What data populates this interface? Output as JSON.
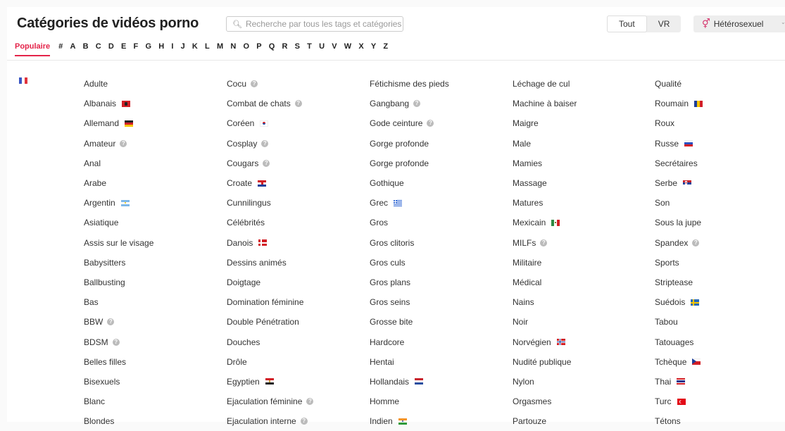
{
  "header": {
    "title": "Catégories de vidéos porno",
    "search_placeholder": "Recherche par tous les tags et catégories",
    "tabs": [
      {
        "label": "Tout",
        "active": true
      },
      {
        "label": "VR",
        "active": false
      }
    ],
    "orientation": {
      "label": "Hétérosexuel",
      "icon": "hetero-gender-icon"
    }
  },
  "letters": [
    "Populaire",
    "#",
    "A",
    "B",
    "C",
    "D",
    "E",
    "F",
    "G",
    "H",
    "I",
    "J",
    "K",
    "L",
    "M",
    "N",
    "O",
    "P",
    "Q",
    "R",
    "S",
    "T",
    "U",
    "V",
    "W",
    "X",
    "Y",
    "Z"
  ],
  "colors": {
    "accent": "#e4244a",
    "help_badge": "#bbbbbb"
  },
  "columns": [
    [
      {
        "name": "Adulte"
      },
      {
        "name": "Albanais",
        "flag": "albania-flag"
      },
      {
        "name": "Allemand",
        "flag": "germany-flag"
      },
      {
        "name": "Amateur",
        "help": true
      },
      {
        "name": "Anal"
      },
      {
        "name": "Arabe"
      },
      {
        "name": "Argentin",
        "flag": "argentina-flag"
      },
      {
        "name": "Asiatique"
      },
      {
        "name": "Assis sur le visage"
      },
      {
        "name": "Babysitters"
      },
      {
        "name": "Ballbusting"
      },
      {
        "name": "Bas"
      },
      {
        "name": "BBW",
        "help": true
      },
      {
        "name": "BDSM",
        "help": true
      },
      {
        "name": "Belles filles"
      },
      {
        "name": "Bisexuels"
      },
      {
        "name": "Blanc"
      },
      {
        "name": "Blondes"
      }
    ],
    [
      {
        "name": "Cocu",
        "help": true
      },
      {
        "name": "Combat de chats",
        "help": true
      },
      {
        "name": "Coréen",
        "flag": "korea-flag"
      },
      {
        "name": "Cosplay",
        "help": true
      },
      {
        "name": "Cougars",
        "help": true
      },
      {
        "name": "Croate",
        "flag": "croatia-flag"
      },
      {
        "name": "Cunnilingus"
      },
      {
        "name": "Célébrités"
      },
      {
        "name": "Danois",
        "flag": "denmark-flag"
      },
      {
        "name": "Dessins animés"
      },
      {
        "name": "Doigtage"
      },
      {
        "name": "Domination féminine"
      },
      {
        "name": "Double Pénétration"
      },
      {
        "name": "Douches"
      },
      {
        "name": "Drôle"
      },
      {
        "name": "Egyptien",
        "flag": "egypt-flag"
      },
      {
        "name": "Ejaculation féminine",
        "help": true
      },
      {
        "name": "Ejaculation interne",
        "help": true
      }
    ],
    [
      {
        "name": "Fétichisme des pieds"
      },
      {
        "name": "Gangbang",
        "help": true
      },
      {
        "name": "Gode ceinture",
        "help": true
      },
      {
        "name": "Gorge profonde"
      },
      {
        "name": "Gorge profonde"
      },
      {
        "name": "Gothique"
      },
      {
        "name": "Grec",
        "flag": "greece-flag"
      },
      {
        "name": "Gros"
      },
      {
        "name": "Gros clitoris"
      },
      {
        "name": "Gros culs"
      },
      {
        "name": "Gros plans"
      },
      {
        "name": "Gros seins"
      },
      {
        "name": "Grosse bite"
      },
      {
        "name": "Hardcore"
      },
      {
        "name": "Hentai"
      },
      {
        "name": "Hollandais",
        "flag": "netherlands-flag"
      },
      {
        "name": "Homme"
      },
      {
        "name": "Indien",
        "flag": "india-flag"
      }
    ],
    [
      {
        "name": "Léchage de cul"
      },
      {
        "name": "Machine à baiser"
      },
      {
        "name": "Maigre"
      },
      {
        "name": "Male"
      },
      {
        "name": "Mamies"
      },
      {
        "name": "Massage"
      },
      {
        "name": "Matures"
      },
      {
        "name": "Mexicain",
        "flag": "mexico-flag"
      },
      {
        "name": "MILFs",
        "help": true
      },
      {
        "name": "Militaire"
      },
      {
        "name": "Médical"
      },
      {
        "name": "Nains"
      },
      {
        "name": "Noir"
      },
      {
        "name": "Norvégien",
        "flag": "norway-flag"
      },
      {
        "name": "Nudité publique"
      },
      {
        "name": "Nylon"
      },
      {
        "name": "Orgasmes"
      },
      {
        "name": "Partouze"
      }
    ],
    [
      {
        "name": "Qualité"
      },
      {
        "name": "Roumain",
        "flag": "romania-flag"
      },
      {
        "name": "Roux"
      },
      {
        "name": "Russe",
        "flag": "russia-flag"
      },
      {
        "name": "Secrétaires"
      },
      {
        "name": "Serbe",
        "flag": "serbia-flag"
      },
      {
        "name": "Son"
      },
      {
        "name": "Sous la jupe"
      },
      {
        "name": "Spandex",
        "help": true
      },
      {
        "name": "Sports"
      },
      {
        "name": "Striptease"
      },
      {
        "name": "Suédois",
        "flag": "sweden-flag"
      },
      {
        "name": "Tabou"
      },
      {
        "name": "Tatouages"
      },
      {
        "name": "Tchèque",
        "flag": "czech-flag"
      },
      {
        "name": "Thai",
        "flag": "thailand-flag"
      },
      {
        "name": "Turc",
        "flag": "turkey-flag"
      },
      {
        "name": "Tétons"
      }
    ]
  ]
}
